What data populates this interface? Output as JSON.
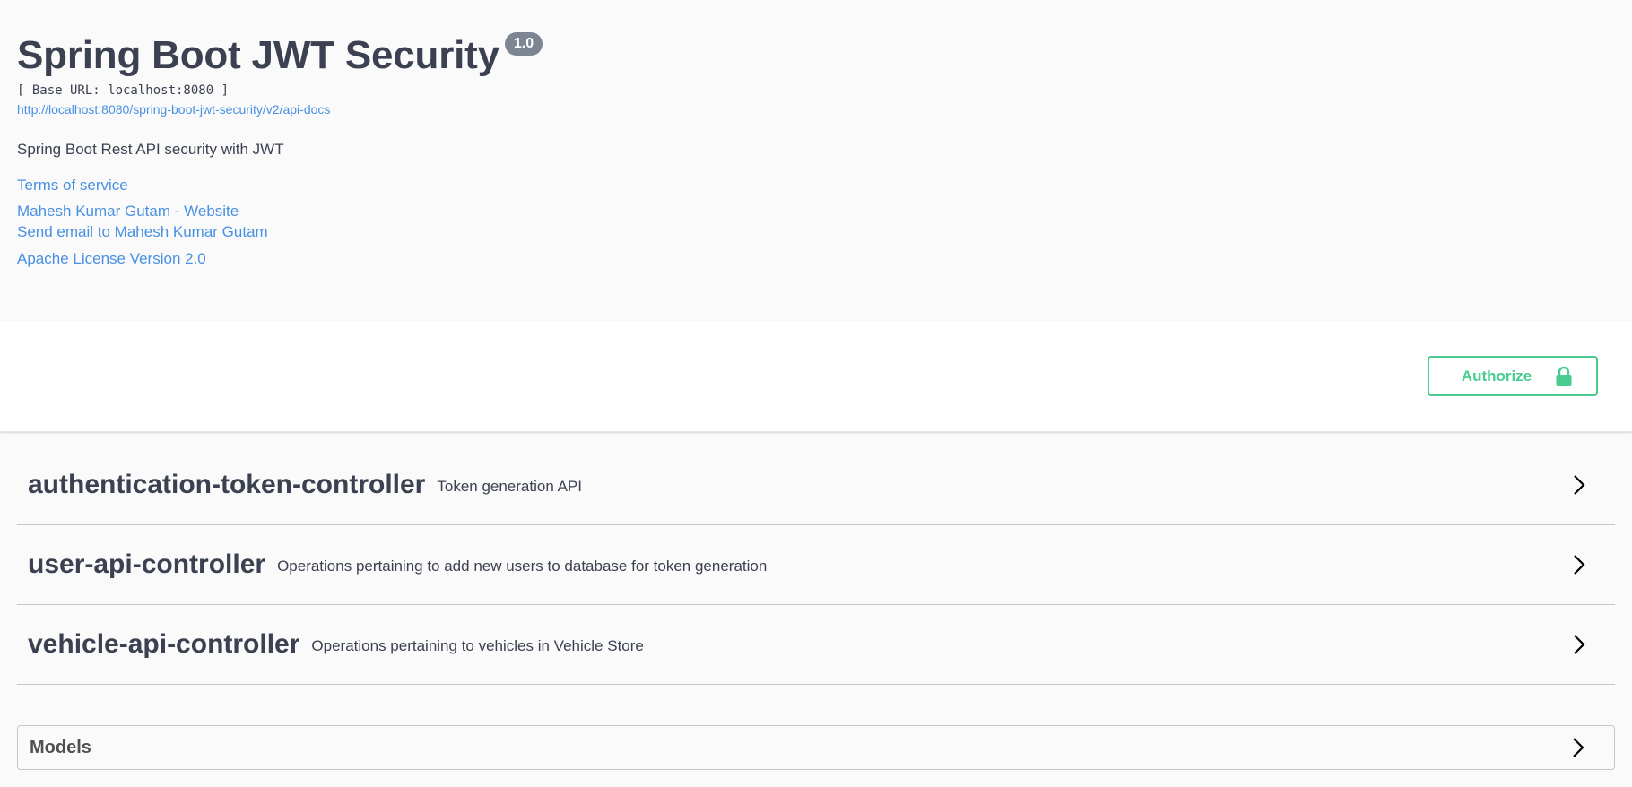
{
  "info": {
    "title": "Spring Boot JWT Security",
    "version": "1.0",
    "base_url": "[ Base URL: localhost:8080 ]",
    "api_docs_url": "http://localhost:8080/spring-boot-jwt-security/v2/api-docs",
    "description": "Spring Boot Rest API security with JWT",
    "terms_of_service": "Terms of service",
    "contact_website": "Mahesh Kumar Gutam - Website",
    "contact_email": "Send email to Mahesh Kumar Gutam",
    "license": "Apache License Version 2.0"
  },
  "auth": {
    "authorize_label": "Authorize",
    "icon": "lock-icon"
  },
  "tags": [
    {
      "name": "authentication-token-controller",
      "description": "Token generation API"
    },
    {
      "name": "user-api-controller",
      "description": "Operations pertaining to add new users to database for token generation"
    },
    {
      "name": "vehicle-api-controller",
      "description": "Operations pertaining to vehicles in Vehicle Store"
    }
  ],
  "models": {
    "title": "Models"
  },
  "colors": {
    "link": "#4990e2",
    "authorize": "#49cc90",
    "text": "#3b4151",
    "badge": "#7d8492"
  }
}
